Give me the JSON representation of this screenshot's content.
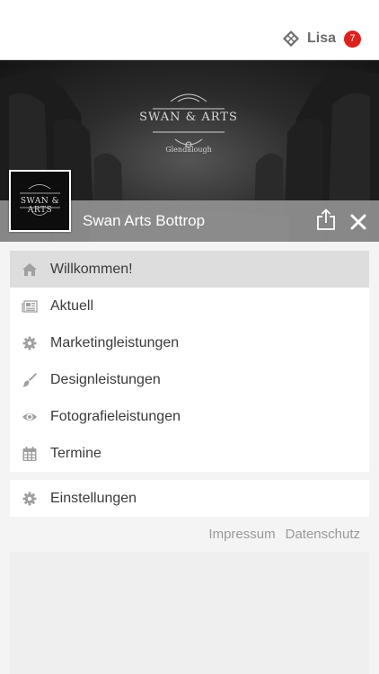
{
  "header": {
    "user_name": "Lisa",
    "notification_count": "7"
  },
  "hero": {
    "logo_text": "SWAN & ARTS",
    "logo_subtext": "Glendalough"
  },
  "profile": {
    "title": "Swan Arts Bottrop",
    "avatar_text": "SWAN & ARTS"
  },
  "menu": {
    "items": [
      {
        "label": "Willkommen!",
        "icon": "home-icon",
        "active": true
      },
      {
        "label": "Aktuell",
        "icon": "newspaper-icon"
      },
      {
        "label": "Marketingleistungen",
        "icon": "gear-icon"
      },
      {
        "label": "Designleistungen",
        "icon": "brush-icon"
      },
      {
        "label": "Fotografieleistungen",
        "icon": "eye-icon"
      },
      {
        "label": "Termine",
        "icon": "calendar-icon"
      }
    ],
    "settings_label": "Einstellungen"
  },
  "footer": {
    "impressum": "Impressum",
    "datenschutz": "Datenschutz"
  },
  "colors": {
    "badge": "#e0201d",
    "active_row": "#dddddd",
    "icon_gray": "#9b9b9b"
  }
}
